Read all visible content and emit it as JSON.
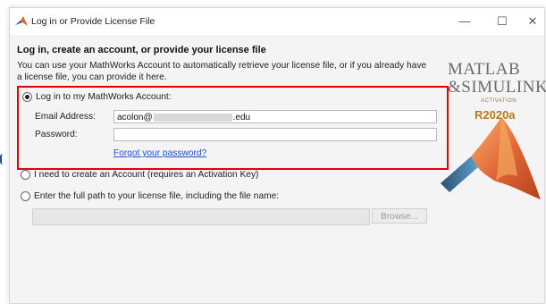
{
  "window": {
    "title": "Log in or Provide License File",
    "controls": {
      "minimize": "—",
      "maximize": "☐",
      "close": "✕"
    }
  },
  "header": {
    "title": "Log in, create an account, or provide your license file"
  },
  "description": "You can use your MathWorks Account to automatically retrieve your license file, or if you already have a license file, you can provide it here.",
  "options": {
    "login": {
      "label": "Log in to my MathWorks Account:",
      "selected": true,
      "email_label": "Email Address:",
      "email_value": "acolon@",
      "email_suffix": ".edu",
      "password_label": "Password:",
      "password_value": "",
      "forgot_link": "Forgot your password?"
    },
    "create_account": {
      "label": "I need to create an Account (requires an Activation Key)",
      "selected": false
    },
    "license_file": {
      "label": "Enter the full path to your license file, including the file name:",
      "selected": false,
      "path_value": "",
      "browse_label": "Browse..."
    }
  },
  "branding": {
    "matlab": "MATLAB",
    "simulink": "&SIMULINK",
    "activation": "ACTIVATION",
    "release": "R2020a"
  },
  "colors": {
    "highlight_box": "#e00000",
    "link": "#1a4fd6",
    "matlab_orange": "#e16737"
  }
}
